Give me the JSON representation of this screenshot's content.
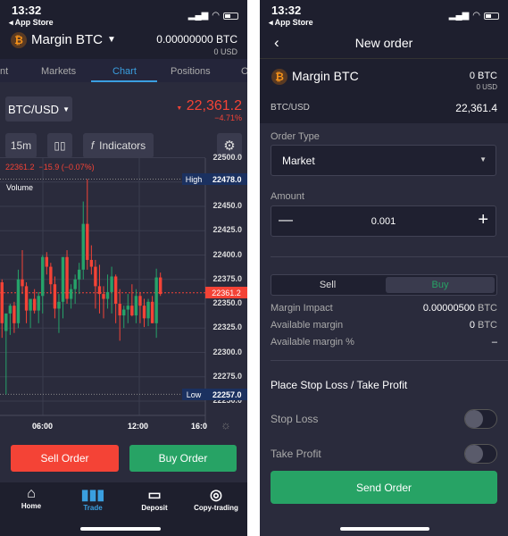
{
  "status": {
    "time": "13:32",
    "back_app": "◂ App Store"
  },
  "left": {
    "account_name": "Margin BTC",
    "balance_btc": "0.00000000 BTC",
    "balance_usd": "0 USD",
    "tabs": [
      "nt",
      "Markets",
      "Chart",
      "Positions",
      "O"
    ],
    "active_tab": "Chart",
    "pair": "BTC/USD",
    "price": "22,361.2",
    "change_pct": "−4.71%",
    "interval": "15m",
    "indicators_label": "Indicators",
    "ohlc_line": "22361.2  −15.9 (−0.07%)",
    "volume_label": "Volume",
    "high_label": "High",
    "high_value": "22478.0",
    "low_label": "Low",
    "low_value": "22257.0",
    "current_tag": "22361.2",
    "sell_label": "Sell Order",
    "buy_label": "Buy Order",
    "nav": [
      {
        "label": "Home",
        "icon": "home-icon"
      },
      {
        "label": "Trade",
        "icon": "bar-chart-icon"
      },
      {
        "label": "Deposit",
        "icon": "wallet-icon"
      },
      {
        "label": "Copy-trading",
        "icon": "copy-trading-icon"
      }
    ],
    "active_nav": "Trade"
  },
  "chart_data": {
    "type": "candlestick",
    "y_ticks": [
      "22500.0",
      "22450.0",
      "22425.0",
      "22400.0",
      "22375.0",
      "22350.0",
      "22325.0",
      "22300.0",
      "22275.0",
      "22250.0"
    ],
    "y_range": [
      22250,
      22500
    ],
    "x_ticks": [
      "06:00",
      "12:00",
      "16:0"
    ],
    "candles": [
      [
        22290,
        22395,
        22280,
        22372
      ],
      [
        22372,
        22375,
        22315,
        22330
      ],
      [
        22322,
        22340,
        22257,
        22340
      ],
      [
        22340,
        22350,
        22318,
        22348
      ],
      [
        22348,
        22352,
        22320,
        22330
      ],
      [
        22330,
        22385,
        22325,
        22375
      ],
      [
        22375,
        22405,
        22360,
        22368
      ],
      [
        22368,
        22372,
        22330,
        22343
      ],
      [
        22343,
        22350,
        22325,
        22355
      ],
      [
        22355,
        22365,
        22340,
        22343
      ],
      [
        22343,
        22362,
        22330,
        22358
      ],
      [
        22358,
        22400,
        22340,
        22398
      ],
      [
        22398,
        22403,
        22380,
        22388
      ],
      [
        22388,
        22392,
        22360,
        22370
      ],
      [
        22370,
        22378,
        22335,
        22345
      ],
      [
        22345,
        22360,
        22320,
        22352
      ],
      [
        22352,
        22375,
        22335,
        22398
      ],
      [
        22398,
        22405,
        22350,
        22355
      ],
      [
        22355,
        22370,
        22345,
        22365
      ],
      [
        22365,
        22380,
        22350,
        22375
      ],
      [
        22375,
        22392,
        22360,
        22385
      ],
      [
        22385,
        22455,
        22375,
        22432
      ],
      [
        22432,
        22478,
        22385,
        22395
      ],
      [
        22395,
        22410,
        22380,
        22388
      ],
      [
        22388,
        22395,
        22345,
        22368
      ],
      [
        22368,
        22390,
        22340,
        22360
      ],
      [
        22360,
        22368,
        22335,
        22355
      ],
      [
        22355,
        22380,
        22345,
        22362
      ],
      [
        22362,
        22388,
        22340,
        22378
      ],
      [
        22378,
        22380,
        22330,
        22350
      ],
      [
        22350,
        22365,
        22312,
        22338
      ],
      [
        22338,
        22348,
        22325,
        22344
      ],
      [
        22344,
        22360,
        22330,
        22348
      ],
      [
        22348,
        22370,
        22337,
        22338
      ],
      [
        22338,
        22365,
        22330,
        22358
      ],
      [
        22358,
        22362,
        22330,
        22348
      ],
      [
        22348,
        22355,
        22326,
        22335
      ],
      [
        22335,
        22355,
        22327,
        22352
      ],
      [
        22352,
        22358,
        22330,
        22330
      ],
      [
        22330,
        22386,
        22315,
        22377
      ],
      [
        22377,
        22382,
        22358,
        22360
      ]
    ],
    "last_price": 22361.2,
    "high": 22478.0,
    "low": 22257.0
  },
  "right": {
    "title": "New order",
    "account_name": "Margin BTC",
    "balance_btc": "0 BTC",
    "balance_usd": "0 USD",
    "pair": "BTC/USD",
    "price": "22,361.4",
    "order_type_label": "Order Type",
    "order_type_value": "Market",
    "amount_label": "Amount",
    "amount_value": "0.001",
    "minus": "—",
    "plus": "+",
    "sell_label": "Sell",
    "buy_label": "Buy",
    "selected_side": "Buy",
    "rows": [
      {
        "label": "Margin Impact",
        "value": "0.00000500",
        "unit": " BTC"
      },
      {
        "label": "Available margin",
        "value": "0",
        "unit": " BTC"
      },
      {
        "label": "Available margin %",
        "value": "–",
        "unit": ""
      }
    ],
    "sltp_title": "Place Stop Loss / Take Profit",
    "stop_loss_label": "Stop Loss",
    "stop_loss_on": false,
    "take_profit_label": "Take Profit",
    "take_profit_on": false,
    "send_label": "Send Order"
  },
  "colors": {
    "up": "#26a269",
    "down": "#f44336",
    "accent": "#3a9fe0",
    "buy_button": "#27a365",
    "sell_button": "#f44336"
  }
}
